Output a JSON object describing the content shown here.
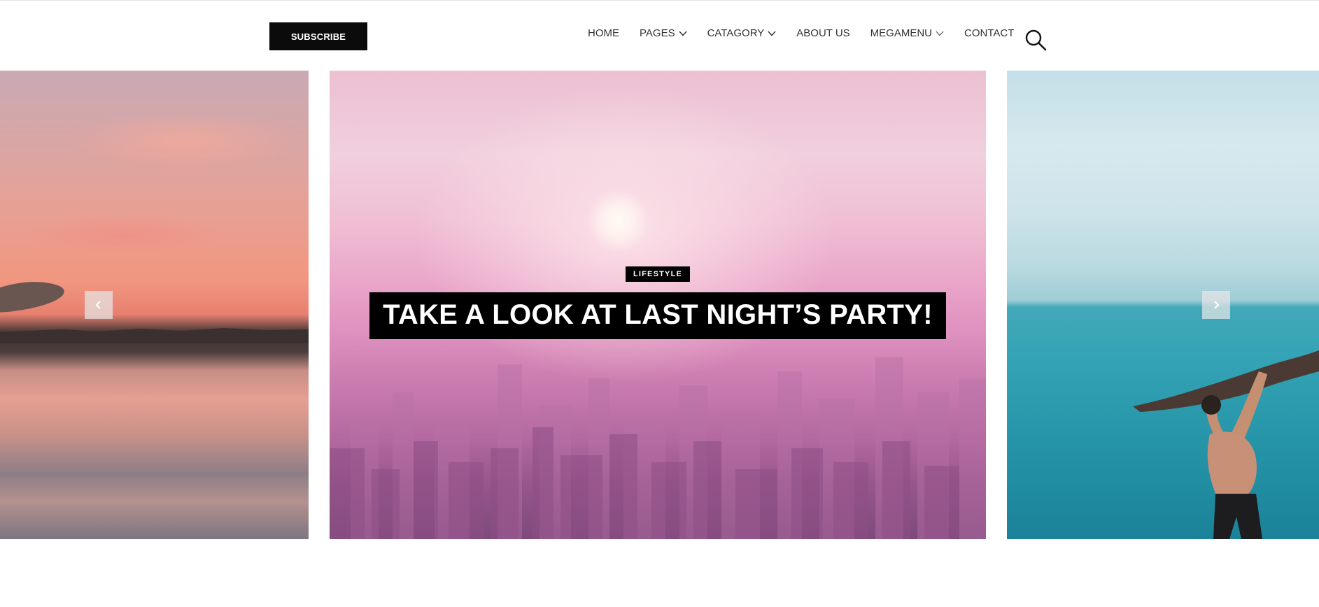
{
  "header": {
    "subscribe_label": "SUBSCRIBE",
    "nav": [
      {
        "label": "HOME",
        "dropdown": false
      },
      {
        "label": "PAGES",
        "dropdown": true
      },
      {
        "label": "CATAGORY",
        "dropdown": true
      },
      {
        "label": "ABOUT US",
        "dropdown": false
      },
      {
        "label": "MEGAMENU",
        "dropdown": true
      },
      {
        "label": "CONTACT",
        "dropdown": false
      }
    ],
    "search_icon": "search-icon"
  },
  "slider": {
    "active_slide": {
      "category": "LIFESTYLE",
      "title": "TAKE A LOOK AT LAST NIGHT’S PARTY!"
    },
    "prev_icon": "chevron-left-icon",
    "next_icon": "chevron-right-icon"
  },
  "colors": {
    "button_bg": "#0b0b0b",
    "nav_text": "#333333",
    "caption_bg": "#000000",
    "caption_text": "#ffffff"
  }
}
